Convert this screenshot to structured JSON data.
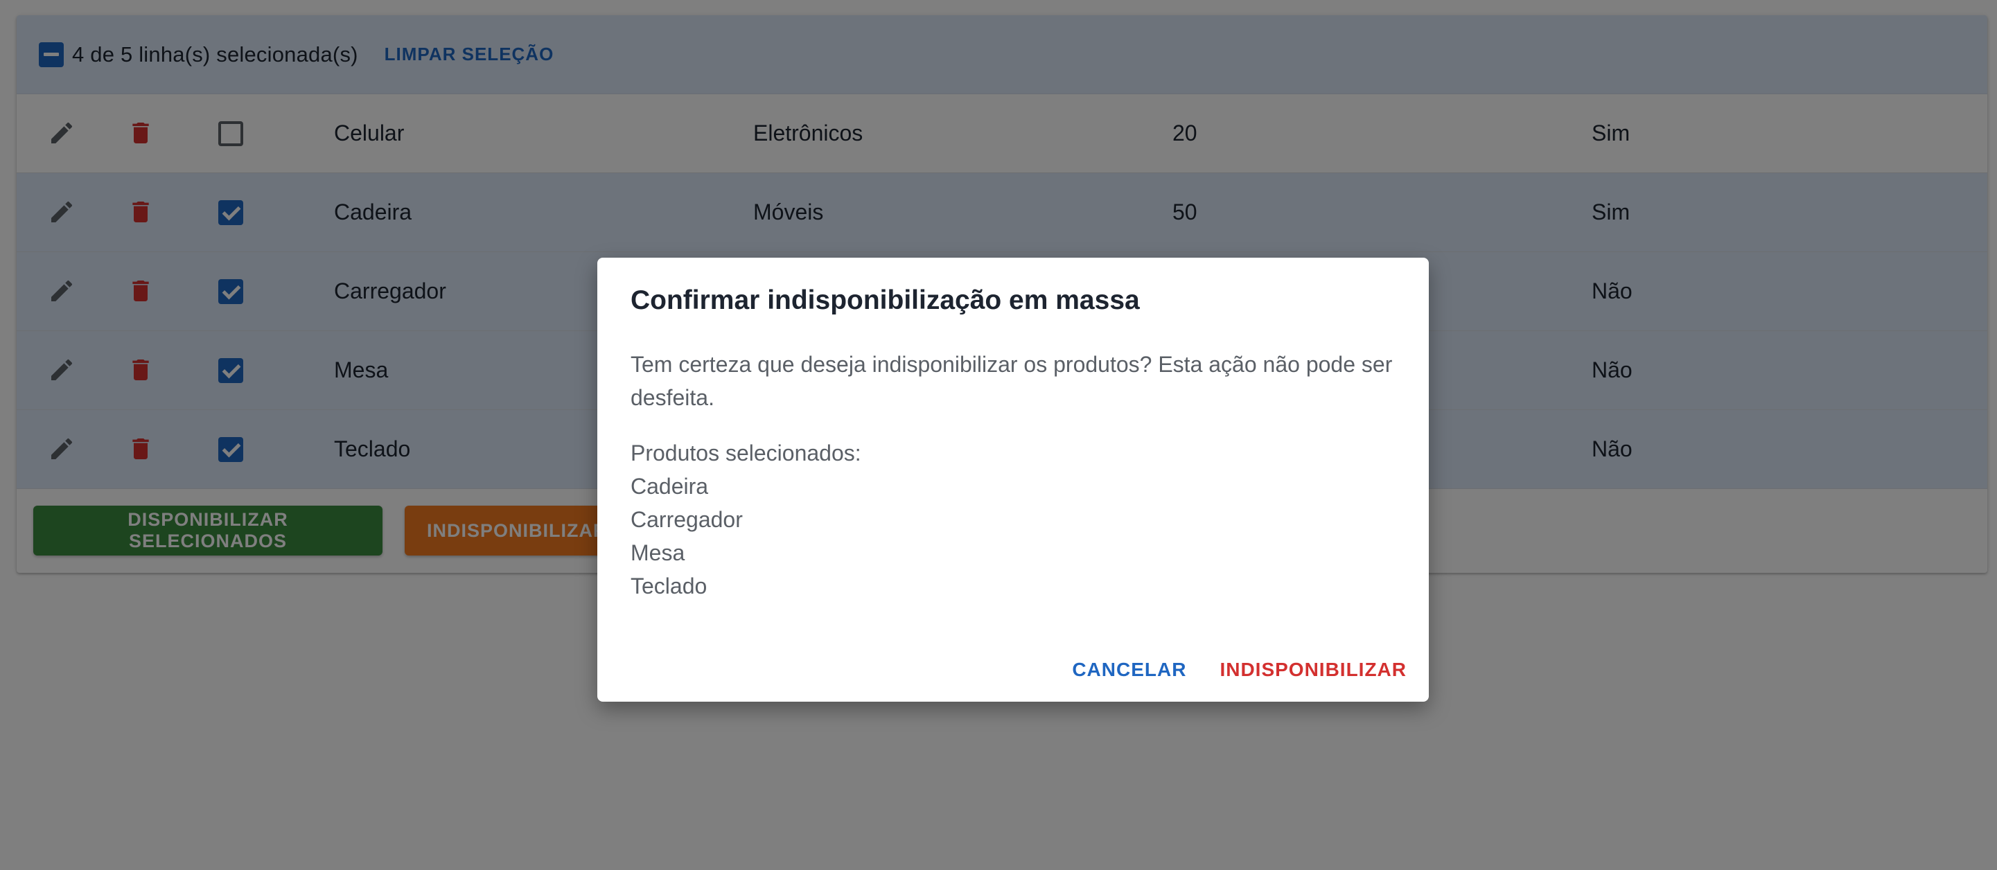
{
  "toolbar": {
    "selection_count": "4 de 5 linha(s) selecionada(s)",
    "clear_selection": "LIMPAR SELEÇÃO"
  },
  "rows": [
    {
      "name": "Celular",
      "category": "Eletrônicos",
      "quantity": "20",
      "available": "Sim",
      "selected": false
    },
    {
      "name": "Cadeira",
      "category": "Móveis",
      "quantity": "50",
      "available": "Sim",
      "selected": true
    },
    {
      "name": "Carregador",
      "category": "",
      "quantity": "",
      "available": "Não",
      "selected": true
    },
    {
      "name": "Mesa",
      "category": "",
      "quantity": "",
      "available": "Não",
      "selected": true
    },
    {
      "name": "Teclado",
      "category": "",
      "quantity": "",
      "available": "Não",
      "selected": true
    }
  ],
  "footer": {
    "enable_selected": "DISPONIBILIZAR SELECIONADOS",
    "disable_selected": "INDISPONIBILIZAR"
  },
  "dialog": {
    "title": "Confirmar indisponibilização em massa",
    "message": "Tem certeza que deseja indisponibilizar os produtos? Esta ação não pode ser desfeita.",
    "list_label": "Produtos selecionados:",
    "items": [
      "Cadeira",
      "Carregador",
      "Mesa",
      "Teclado"
    ],
    "cancel": "CANCELAR",
    "confirm": "INDISPONIBILIZAR"
  },
  "colors": {
    "primary": "#1f66c1",
    "danger": "#d3302f",
    "success": "#3a8a3e",
    "warning": "#f27b20",
    "selected_row": "#dbe7f6"
  },
  "icons": {
    "edit": "pencil-icon",
    "delete": "trash-icon",
    "bulk_select": "indeterminate-checkbox-icon"
  }
}
